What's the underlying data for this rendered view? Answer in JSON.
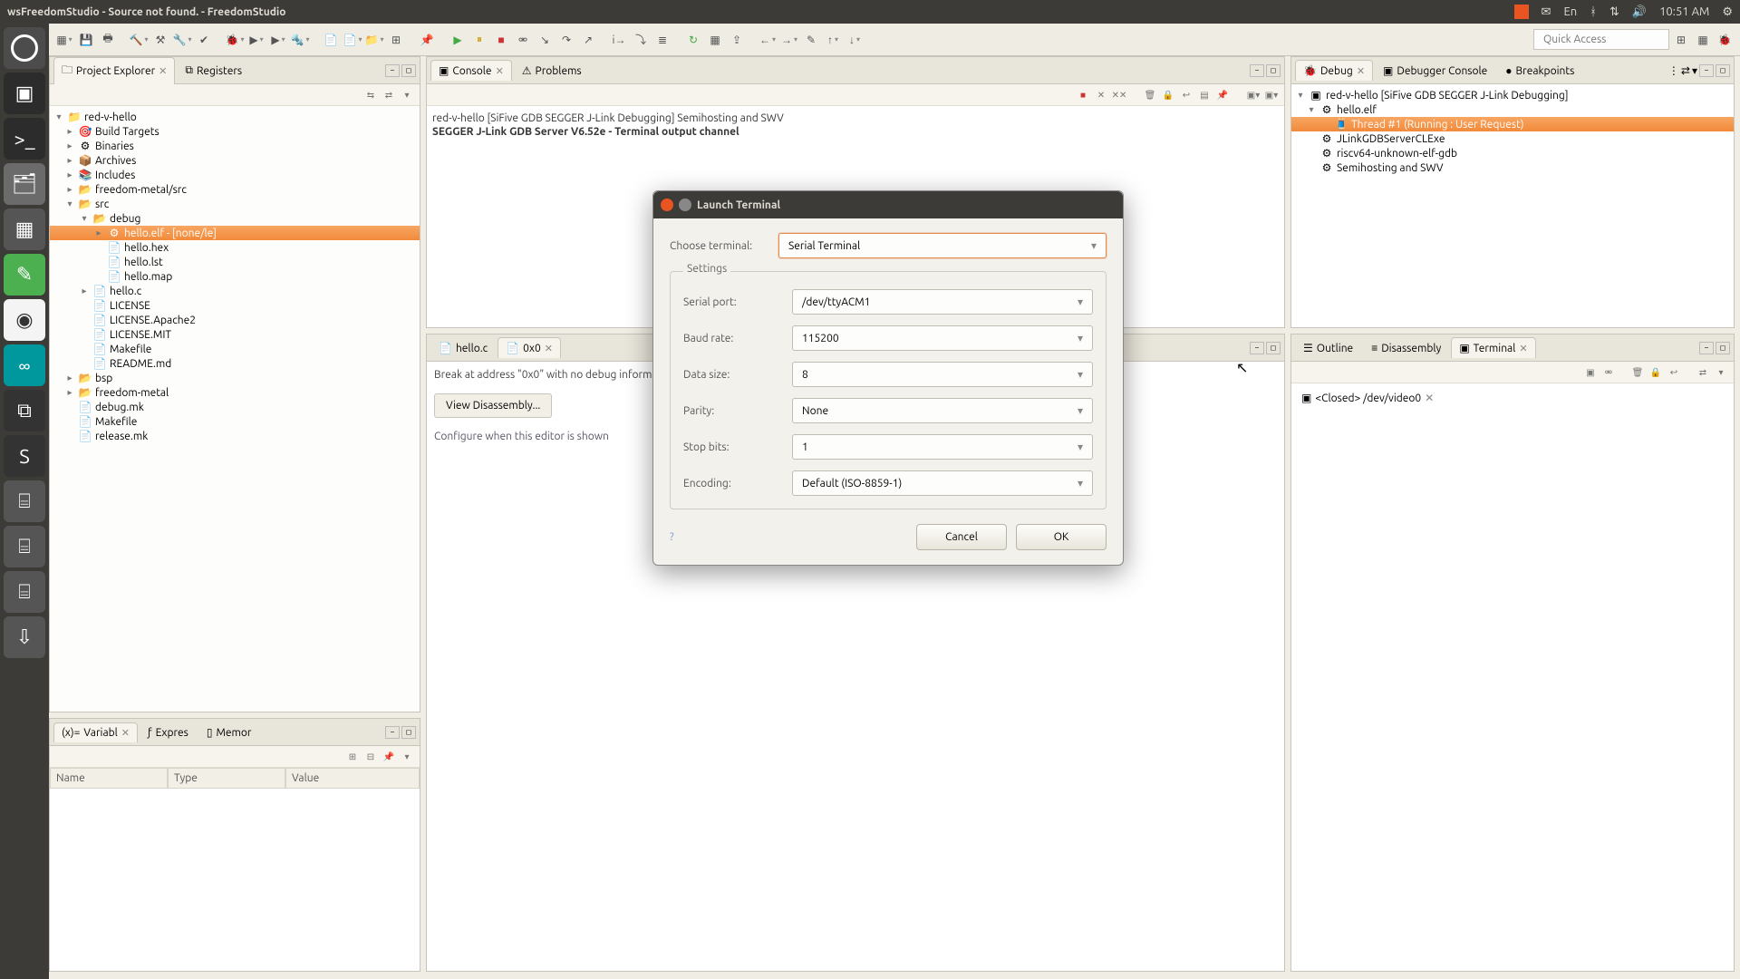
{
  "menubar": {
    "title": "wsFreedomStudio - Source not found. - FreedomStudio",
    "lang": "En",
    "time": "10:51 AM"
  },
  "quick_access": "Quick Access",
  "left": {
    "project_explorer_tab": "Project Explorer",
    "registers_tab": "Registers",
    "tree": {
      "root": "red-v-hello",
      "build_targets": "Build Targets",
      "binaries": "Binaries",
      "archives": "Archives",
      "includes": "Includes",
      "freedom_metal_src": "freedom-metal/src",
      "src": "src",
      "debug": "debug",
      "hello_elf": "hello.elf - [none/le]",
      "hello_hex": "hello.hex",
      "hello_lst": "hello.lst",
      "hello_map": "hello.map",
      "hello_c": "hello.c",
      "license": "LICENSE",
      "license_apache": "LICENSE.Apache2",
      "license_mit": "LICENSE.MIT",
      "makefile": "Makefile",
      "readme": "README.md",
      "bsp": "bsp",
      "freedom_metal": "freedom-metal",
      "debug_mk": "debug.mk",
      "makefile2": "Makefile",
      "release_mk": "release.mk"
    },
    "variables": {
      "tab_variables": "Variabl",
      "tab_expressions": "Expres",
      "tab_memory": "Memor",
      "col_name": "Name",
      "col_type": "Type",
      "col_value": "Value"
    }
  },
  "center": {
    "console_tab": "Console",
    "problems_tab": "Problems",
    "console_line1": "red-v-hello [SiFive GDB SEGGER J-Link Debugging] Semihosting and SWV",
    "console_line2": "SEGGER J-Link GDB Server V6.52e - Terminal output channel",
    "editor_tab1": "hello.c",
    "editor_tab2": "0x0",
    "break_msg": "Break at address \"0x0\" with no debug information available.",
    "view_dis": "View Disassembly...",
    "config_msg": "Configure when this editor is shown"
  },
  "right": {
    "debug_tab": "Debug",
    "debugger_console_tab": "Debugger Console",
    "breakpoints_tab": "Breakpoints",
    "debug_tree": {
      "root": "red-v-hello [SiFive GDB SEGGER J-Link Debugging]",
      "elf": "hello.elf",
      "thread": "Thread #1 (Running : User Request)",
      "jlink": "JLinkGDBServerCLExe",
      "gdb": "riscv64-unknown-elf-gdb",
      "semi": "Semihosting and SWV"
    },
    "outline_tab": "Outline",
    "disassembly_tab": "Disassembly",
    "terminal_tab": "Terminal",
    "terminal_item": "<Closed> /dev/video0"
  },
  "dialog": {
    "title": "Launch Terminal",
    "choose_terminal_label": "Choose terminal:",
    "choose_terminal_value": "Serial Terminal",
    "settings_legend": "Settings",
    "serial_port_label": "Serial port:",
    "serial_port_value": "/dev/ttyACM1",
    "baud_label": "Baud rate:",
    "baud_value": "115200",
    "data_size_label": "Data size:",
    "data_size_value": "8",
    "parity_label": "Parity:",
    "parity_value": "None",
    "stop_bits_label": "Stop bits:",
    "stop_bits_value": "1",
    "encoding_label": "Encoding:",
    "encoding_value": "Default (ISO-8859-1)",
    "cancel": "Cancel",
    "ok": "OK"
  }
}
